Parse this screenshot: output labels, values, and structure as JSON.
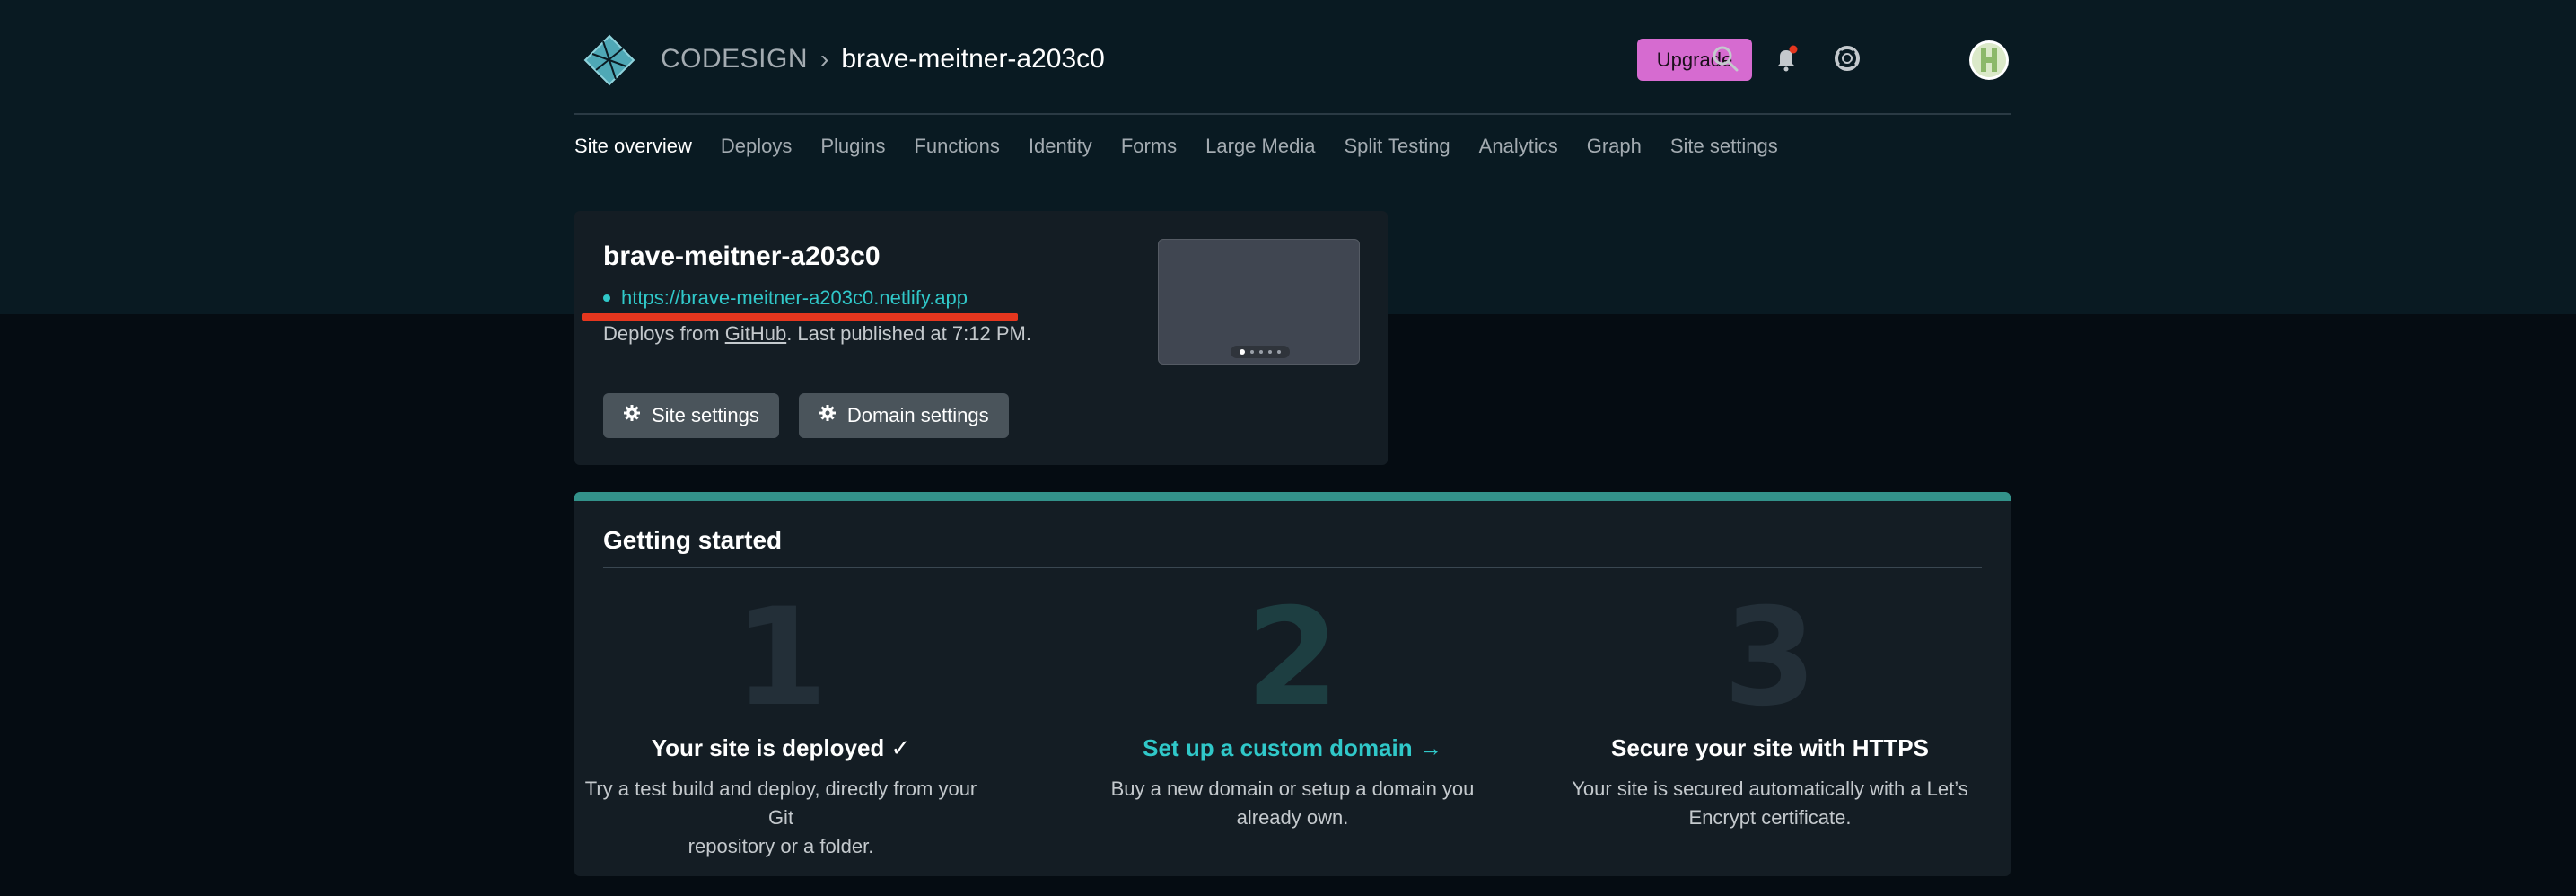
{
  "header": {
    "team": "CODESIGN",
    "separator": "›",
    "site": "brave-meitner-a203c0",
    "upgrade_label": "Upgrade"
  },
  "nav": {
    "items": [
      {
        "label": "Site overview",
        "active": true
      },
      {
        "label": "Deploys"
      },
      {
        "label": "Plugins"
      },
      {
        "label": "Functions"
      },
      {
        "label": "Identity"
      },
      {
        "label": "Forms"
      },
      {
        "label": "Large Media"
      },
      {
        "label": "Split Testing"
      },
      {
        "label": "Analytics"
      },
      {
        "label": "Graph"
      },
      {
        "label": "Site settings"
      }
    ]
  },
  "site_card": {
    "name": "brave-meitner-a203c0",
    "url": "https://brave-meitner-a203c0.netlify.app",
    "deploy_prefix": "Deploys from ",
    "deploy_source": "GitHub",
    "deploy_suffix": ". Last published at 7:12 PM.",
    "site_settings_label": "Site settings",
    "domain_settings_label": "Domain settings"
  },
  "getting_started": {
    "title": "Getting started",
    "steps": [
      {
        "number": "1",
        "title": "Your site is deployed ✓",
        "desc_line1": "Try a test build and deploy, directly from your Git",
        "desc_line2": "repository or a folder."
      },
      {
        "number": "2",
        "title": "Set up a custom domain →",
        "desc_line1": "Buy a new domain or setup a domain you",
        "desc_line2": "already own."
      },
      {
        "number": "3",
        "title": "Secure your site with HTTPS",
        "desc_line1": "Your site is secured automatically with a Let’s",
        "desc_line2": "Encrypt certificate."
      }
    ]
  },
  "colors": {
    "accent_teal": "#30c8c9",
    "upgrade_pink": "#d66bd0",
    "highlight_red": "#e5361e",
    "notification_dot": "#e5361e"
  },
  "icons": [
    "netlify-logo-icon",
    "search-icon",
    "bell-icon",
    "help-lifebuoy-icon",
    "gear-icon"
  ]
}
